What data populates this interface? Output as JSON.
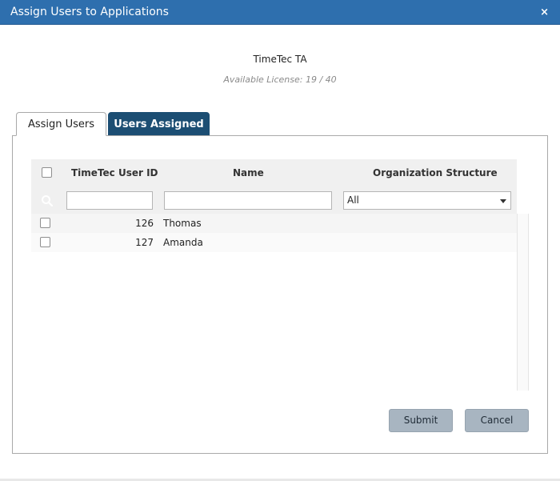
{
  "dialog": {
    "title": "Assign Users to Applications",
    "close_label": "×"
  },
  "app": {
    "name": "TimeTec TA",
    "license": "Available License: 19 / 40"
  },
  "tabs": [
    {
      "label": "Assign Users",
      "active": true
    },
    {
      "label": "Users Assigned",
      "active": false
    }
  ],
  "grid": {
    "columns": {
      "user_id": "TimeTec User ID",
      "name": "Name",
      "org": "Organization Structure"
    },
    "filters": {
      "user_id": "",
      "name": "",
      "org_selected": "All"
    },
    "rows": [
      {
        "id": "126",
        "name": "Thomas"
      },
      {
        "id": "127",
        "name": "Amanda"
      }
    ]
  },
  "buttons": {
    "submit": "Submit",
    "cancel": "Cancel"
  },
  "icons": {
    "search": "search-icon",
    "close": "close-icon",
    "dropdown": "chevron-down-icon"
  },
  "colors": {
    "titlebar": "#2e6fae",
    "active_tab_dark": "#1c4e73",
    "button": "#a8b5c1"
  }
}
